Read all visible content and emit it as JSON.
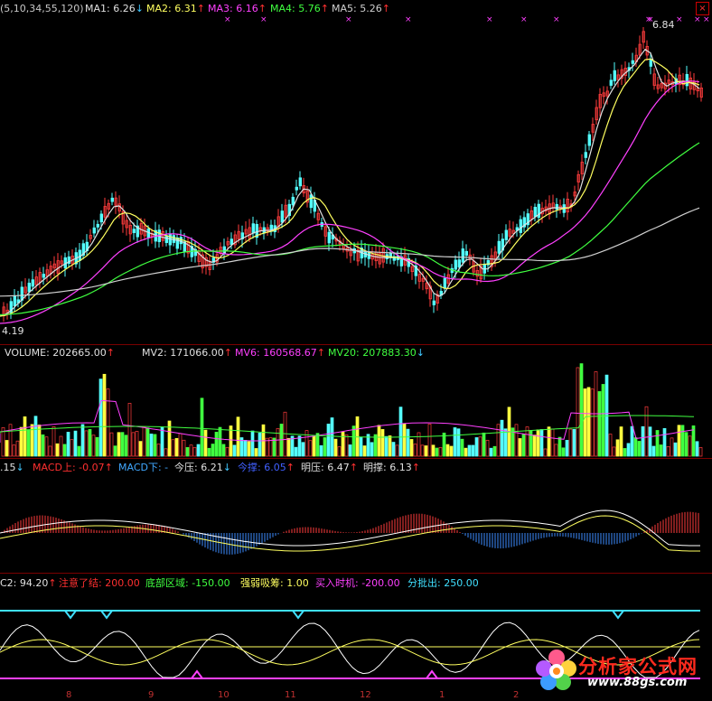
{
  "price_pane": {
    "items": [
      {
        "text": "(5,10,34,55,120)",
        "color": "#c8c8c8"
      },
      {
        "text": "MA1: 6.26",
        "color": "#e0e0e0",
        "arrow": "↓",
        "arrow_color": "#40c8ff"
      },
      {
        "text": "MA2: 6.31",
        "color": "#ffff60",
        "arrow": "↑",
        "arrow_color": "#ff3030"
      },
      {
        "text": "MA3: 6.16",
        "color": "#ff40ff",
        "arrow": "↑",
        "arrow_color": "#ff3030"
      },
      {
        "text": "MA4: 5.76",
        "color": "#40ff40",
        "arrow": "↑",
        "arrow_color": "#ff3030"
      },
      {
        "text": "MA5: 5.26",
        "color": "#d0d0d0",
        "arrow": "↑",
        "arrow_color": "#ff3030"
      }
    ],
    "high_label": "6.84",
    "low_label": "4.19"
  },
  "volume_pane": {
    "items": [
      {
        "text": "VOLUME: 202665.00",
        "color": "#e0e0e0",
        "arrow": "↑",
        "arrow_color": "#ff3030"
      },
      {
        "text": "MV2: 171066.00",
        "color": "#e0e0e0",
        "arrow": "↑",
        "arrow_color": "#ff3030"
      },
      {
        "text": "MV6: 160568.67",
        "color": "#ff40ff",
        "arrow": "↑",
        "arrow_color": "#ff3030"
      },
      {
        "text": "MV20: 207883.30",
        "color": "#40ff40",
        "arrow": "↓",
        "arrow_color": "#40c8ff"
      }
    ]
  },
  "macd_pane": {
    "items": [
      {
        "text": ".15",
        "color": "#e0e0e0",
        "arrow": "↓",
        "arrow_color": "#40c8ff"
      },
      {
        "text": "MACD上: -0.07",
        "color": "#ff3030",
        "arrow": "↑",
        "arrow_color": "#ff3030"
      },
      {
        "text": "MACD下: -",
        "color": "#40a8ff",
        "arrow": "",
        "arrow_color": ""
      },
      {
        "text": "今压: 6.21",
        "color": "#e0e0e0",
        "arrow": "↓",
        "arrow_color": "#40c8ff"
      },
      {
        "text": "今撑: 6.05",
        "color": "#4060ff",
        "arrow": "↑",
        "arrow_color": "#ff3030"
      },
      {
        "text": "明压: 6.47",
        "color": "#e0e0e0",
        "arrow": "↑",
        "arrow_color": "#ff3030"
      },
      {
        "text": "明撑: 6.13",
        "color": "#e0e0e0",
        "arrow": "↑",
        "arrow_color": "#ff3030"
      }
    ]
  },
  "indicator_pane": {
    "items": [
      {
        "text": "C2: 94.20",
        "color": "#e0e0e0",
        "arrow": "↑",
        "arrow_color": "#ff3030"
      },
      {
        "text": "注意了结: 200.00",
        "color": "#ff3030",
        "arrow": "",
        "arrow_color": ""
      },
      {
        "text": "底部区域: -150.00",
        "color": "#40ff40",
        "arrow": "",
        "arrow_color": ""
      },
      {
        "text": "强弱吸筹: 1.00",
        "color": "#ffff60",
        "arrow": "",
        "arrow_color": ""
      },
      {
        "text": "买入时机: -200.00",
        "color": "#ff40ff",
        "arrow": "",
        "arrow_color": ""
      },
      {
        "text": "分批出: 250.00",
        "color": "#40e0ff",
        "arrow": "",
        "arrow_color": ""
      }
    ]
  },
  "x_axis_ticks": [
    "8",
    "9",
    "10",
    "11",
    "12",
    "1",
    "2"
  ],
  "watermark": {
    "site_name": "分析家公式网",
    "url": "www.88gs.com"
  },
  "colors": {
    "up": "#ff3c3c",
    "down": "#54ffff",
    "ma1": "#e0e0e0",
    "ma2": "#ffff60",
    "ma3": "#ff40ff",
    "ma4": "#40ff40",
    "ma5": "#d0d0d0",
    "frame": "#7a0000"
  }
}
